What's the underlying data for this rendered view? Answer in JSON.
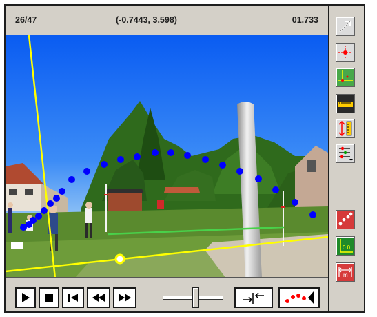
{
  "status": {
    "frame_counter": "26/47",
    "coordinates": "(-0.7443, 3.598)",
    "time": "01.733"
  },
  "colors": {
    "marker": "#0000ff",
    "axis": "#ffff00",
    "calibration": "#49d14a",
    "panel": "#d4d0c8",
    "tool_red": "#ff0000"
  },
  "playback": {
    "buttons": [
      "play-icon",
      "stop-icon",
      "step-back-icon",
      "rewind-icon",
      "fast-forward-icon"
    ],
    "slider_position": 0.55,
    "extra_buttons": [
      "set-range-icon",
      "track-marker-icon"
    ]
  },
  "toolbar": {
    "tools": [
      "arrow-icon",
      "crosshair-icon",
      "coordinate-axes-icon",
      "ruler-icon",
      "scale-length-icon",
      "list-options-icon"
    ],
    "result_tools": [
      "trajectory-icon",
      "zero-point-icon",
      "distance-icon"
    ],
    "distance_label": "m",
    "zero_label": "0.0"
  },
  "video": {
    "description_icon": "ball-throw-video"
  }
}
